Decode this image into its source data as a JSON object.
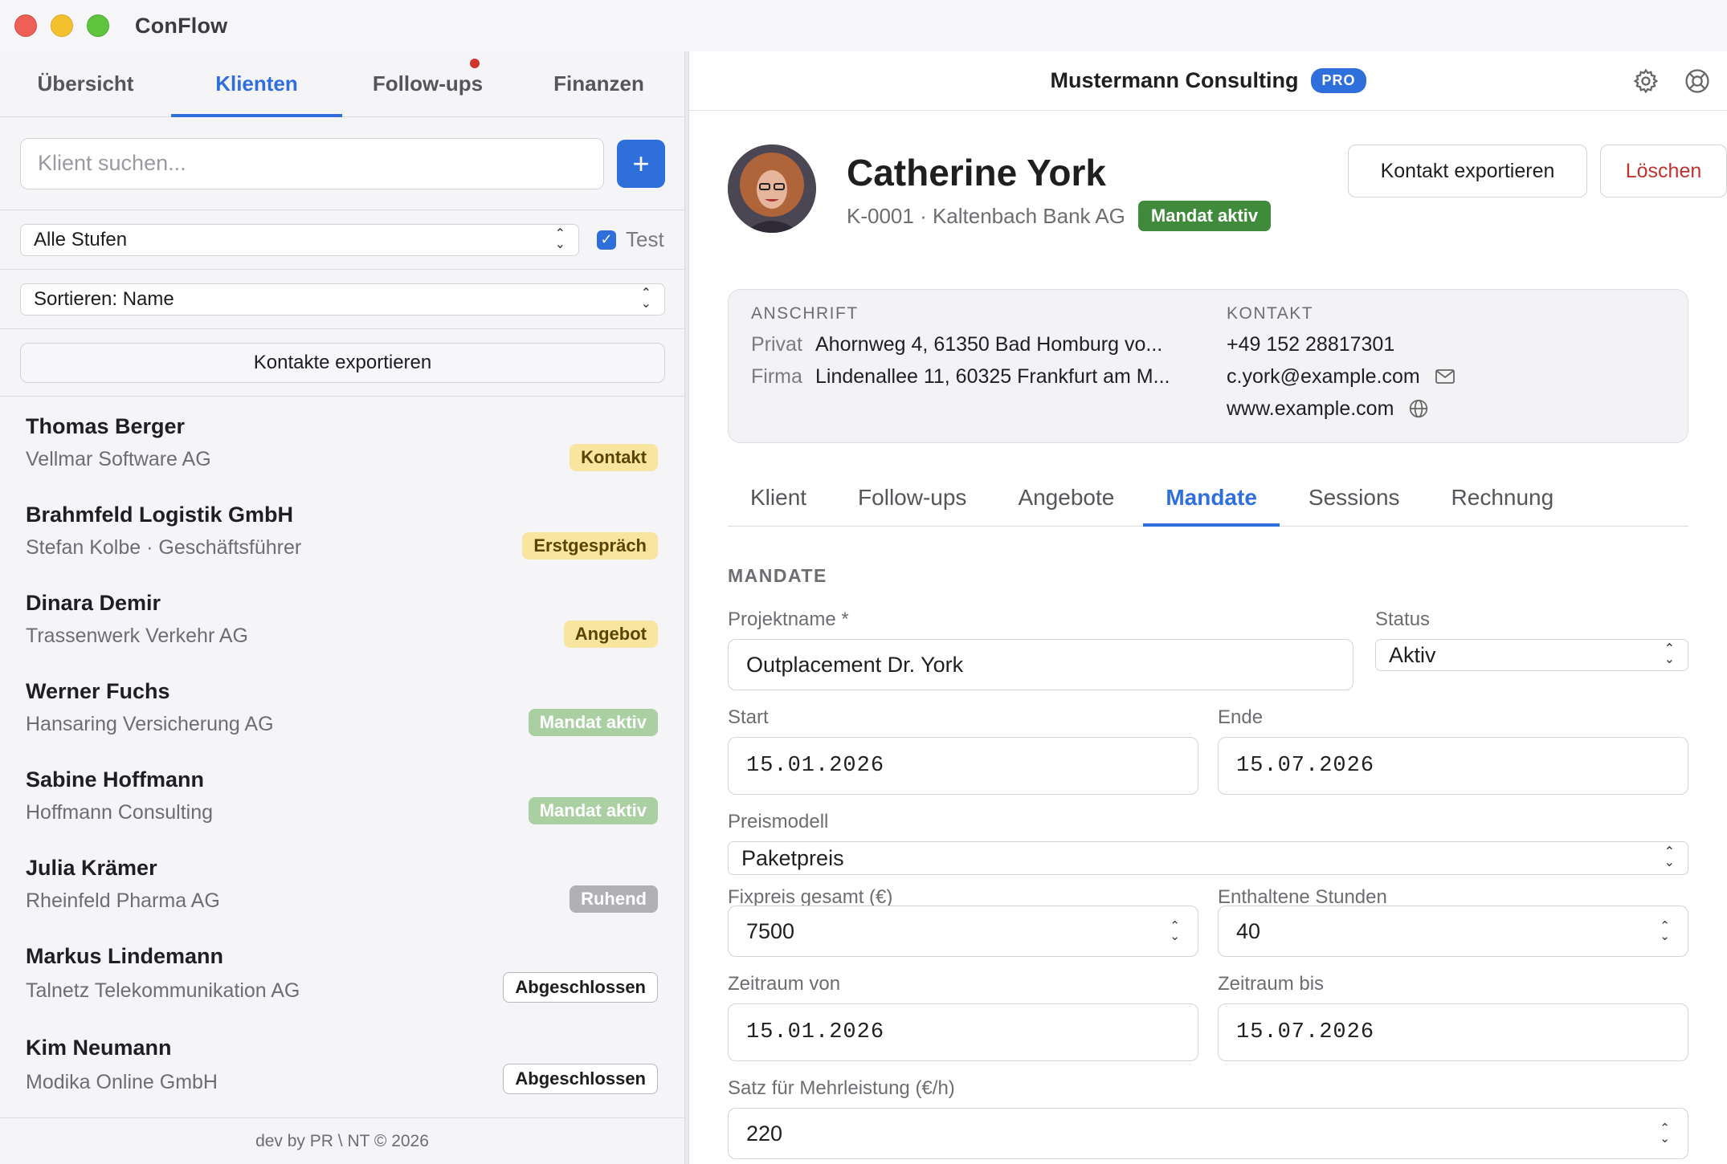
{
  "app": {
    "title": "ConFlow"
  },
  "sidebar": {
    "tabs": [
      {
        "label": "Übersicht"
      },
      {
        "label": "Klienten",
        "active": true
      },
      {
        "label": "Follow-ups",
        "has_notification": true
      },
      {
        "label": "Finanzen"
      }
    ],
    "search": {
      "placeholder": "Klient suchen...",
      "add_label": "+"
    },
    "filter": {
      "stage": "Alle Stufen",
      "test_label": "Test",
      "test_checked": true
    },
    "sort": {
      "value": "Sortieren: Name"
    },
    "export_label": "Kontakte exportieren",
    "clients": [
      {
        "name": "Thomas Berger",
        "sub": "Vellmar Software AG",
        "badge": "Kontakt"
      },
      {
        "name": "Brahmfeld Logistik GmbH",
        "sub": "Stefan Kolbe · Geschäftsführer",
        "badge": "Erstgespräch"
      },
      {
        "name": "Dinara Demir",
        "sub": "Trassenwerk Verkehr AG",
        "badge": "Angebot"
      },
      {
        "name": "Werner Fuchs",
        "sub": "Hansaring Versicherung AG",
        "badge": "Mandat aktiv"
      },
      {
        "name": "Sabine Hoffmann",
        "sub": "Hoffmann Consulting",
        "badge": "Mandat aktiv"
      },
      {
        "name": "Julia Krämer",
        "sub": "Rheinfeld Pharma AG",
        "badge": "Ruhend"
      },
      {
        "name": "Markus Lindemann",
        "sub": "Talnetz Telekommunikation AG",
        "badge": "Abgeschlossen"
      },
      {
        "name": "Kim Neumann",
        "sub": "Modika Online GmbH",
        "badge": "Abgeschlossen"
      }
    ],
    "footer": "dev by PR \\ NT © 2026"
  },
  "header": {
    "company": "Mustermann Consulting",
    "plan_badge": "PRO"
  },
  "profile": {
    "name": "Catherine York",
    "id_line": "K-0001 · Kaltenbach Bank AG",
    "status": "Mandat aktiv",
    "export_button": "Kontakt exportieren",
    "delete_button": "Löschen"
  },
  "address": {
    "heading": "ANSCHRIFT",
    "private_label": "Privat",
    "private_value": "Ahornweg 4, 61350 Bad Homburg vo...",
    "company_label": "Firma",
    "company_value": "Lindenallee 11, 60325 Frankfurt am M..."
  },
  "contact": {
    "heading": "KONTAKT",
    "phone": "+49 152 28817301",
    "email": "c.york@example.com",
    "website": "www.example.com"
  },
  "detail_tabs": [
    {
      "label": "Klient"
    },
    {
      "label": "Follow-ups"
    },
    {
      "label": "Angebote"
    },
    {
      "label": "Mandate",
      "active": true
    },
    {
      "label": "Sessions"
    },
    {
      "label": "Rechnung"
    }
  ],
  "mandate": {
    "section_title": "MANDATE",
    "project_label": "Projektname *",
    "project_value": "Outplacement Dr. York",
    "status_label": "Status",
    "status_value": "Aktiv",
    "start_label": "Start",
    "start_value": "15.01.2026",
    "end_label": "Ende",
    "end_value": "15.07.2026",
    "pricing_label": "Preismodell",
    "pricing_value": "Paketpreis",
    "fixprice_label": "Fixpreis gesamt (€)",
    "fixprice_value": "7500",
    "hours_label": "Enthaltene Stunden",
    "hours_value": "40",
    "period_from_label": "Zeitraum von",
    "period_from_value": "15.01.2026",
    "period_to_label": "Zeitraum bis",
    "period_to_value": "15.07.2026",
    "extra_rate_label": "Satz für Mehrleistung (€/h)",
    "extra_rate_value": "220"
  },
  "colors": {
    "accent": "#2f6fdb",
    "status_active": "#3f8a3b",
    "delete_text": "#c0322b",
    "badge_warm": "#f8e5a0",
    "badge_green": "#a9cfa3",
    "badge_grey": "#b0b0b5"
  },
  "icons": {
    "settings": "gear-icon",
    "help": "lifebuoy-icon",
    "email": "envelope-icon",
    "website": "globe-icon"
  }
}
